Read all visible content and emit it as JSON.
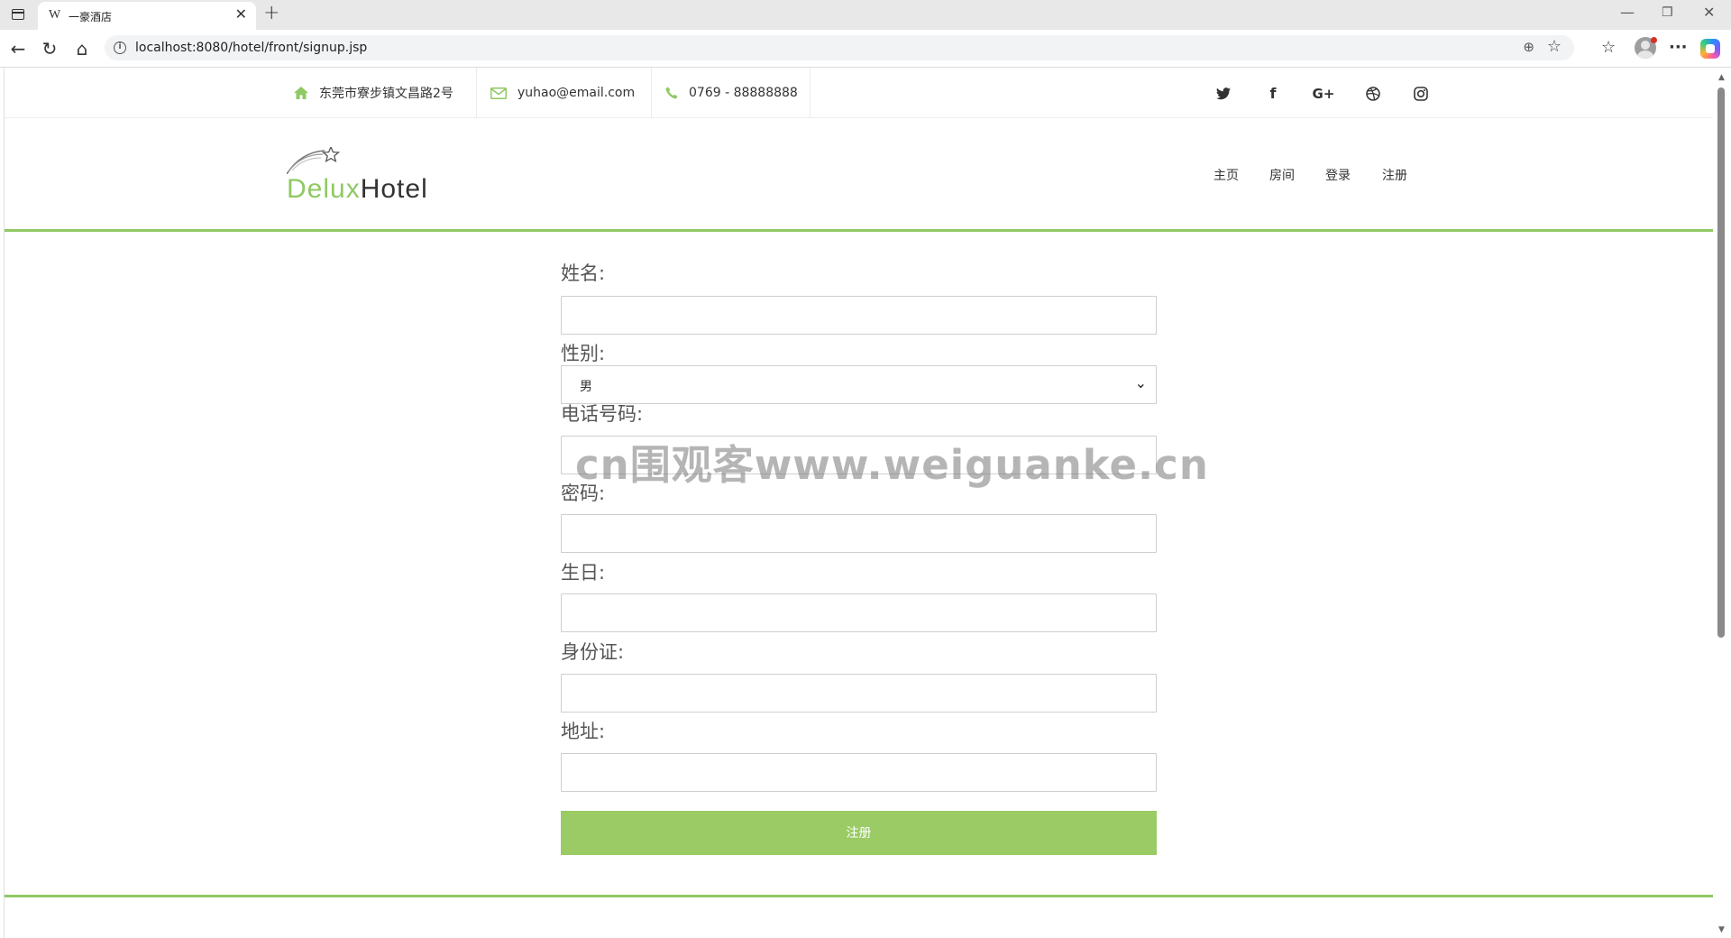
{
  "browser": {
    "tab_favicon": "W",
    "tab_title": "一豪酒店",
    "url": "localhost:8080/hotel/front/signup.jsp"
  },
  "topbar": {
    "address": "东莞市寮步镇文昌路2号",
    "email": "yuhao@email.com",
    "phone": "0769 - 88888888",
    "social_icons": [
      "twitter-icon",
      "facebook-icon",
      "google-plus-icon",
      "dribbble-icon",
      "instagram-icon"
    ]
  },
  "header": {
    "logo_part1": "Delux",
    "logo_part2": "Hotel",
    "nav": [
      "主页",
      "房间",
      "登录",
      "注册"
    ]
  },
  "form": {
    "name_label": "姓名:",
    "name_value": "",
    "gender_label": "性别:",
    "gender_value": "男",
    "phone_label": "电话号码:",
    "phone_value": "",
    "password_label": "密码:",
    "password_value": "",
    "birthday_label": "生日:",
    "birthday_value": "",
    "id_label": "身份证:",
    "id_value": "",
    "address_label": "地址:",
    "address_value": "",
    "submit_label": "注册"
  },
  "watermark": "cn围观客www.weiguanke.cn",
  "colors": {
    "accent": "#8fc963",
    "button": "#9acb64"
  }
}
